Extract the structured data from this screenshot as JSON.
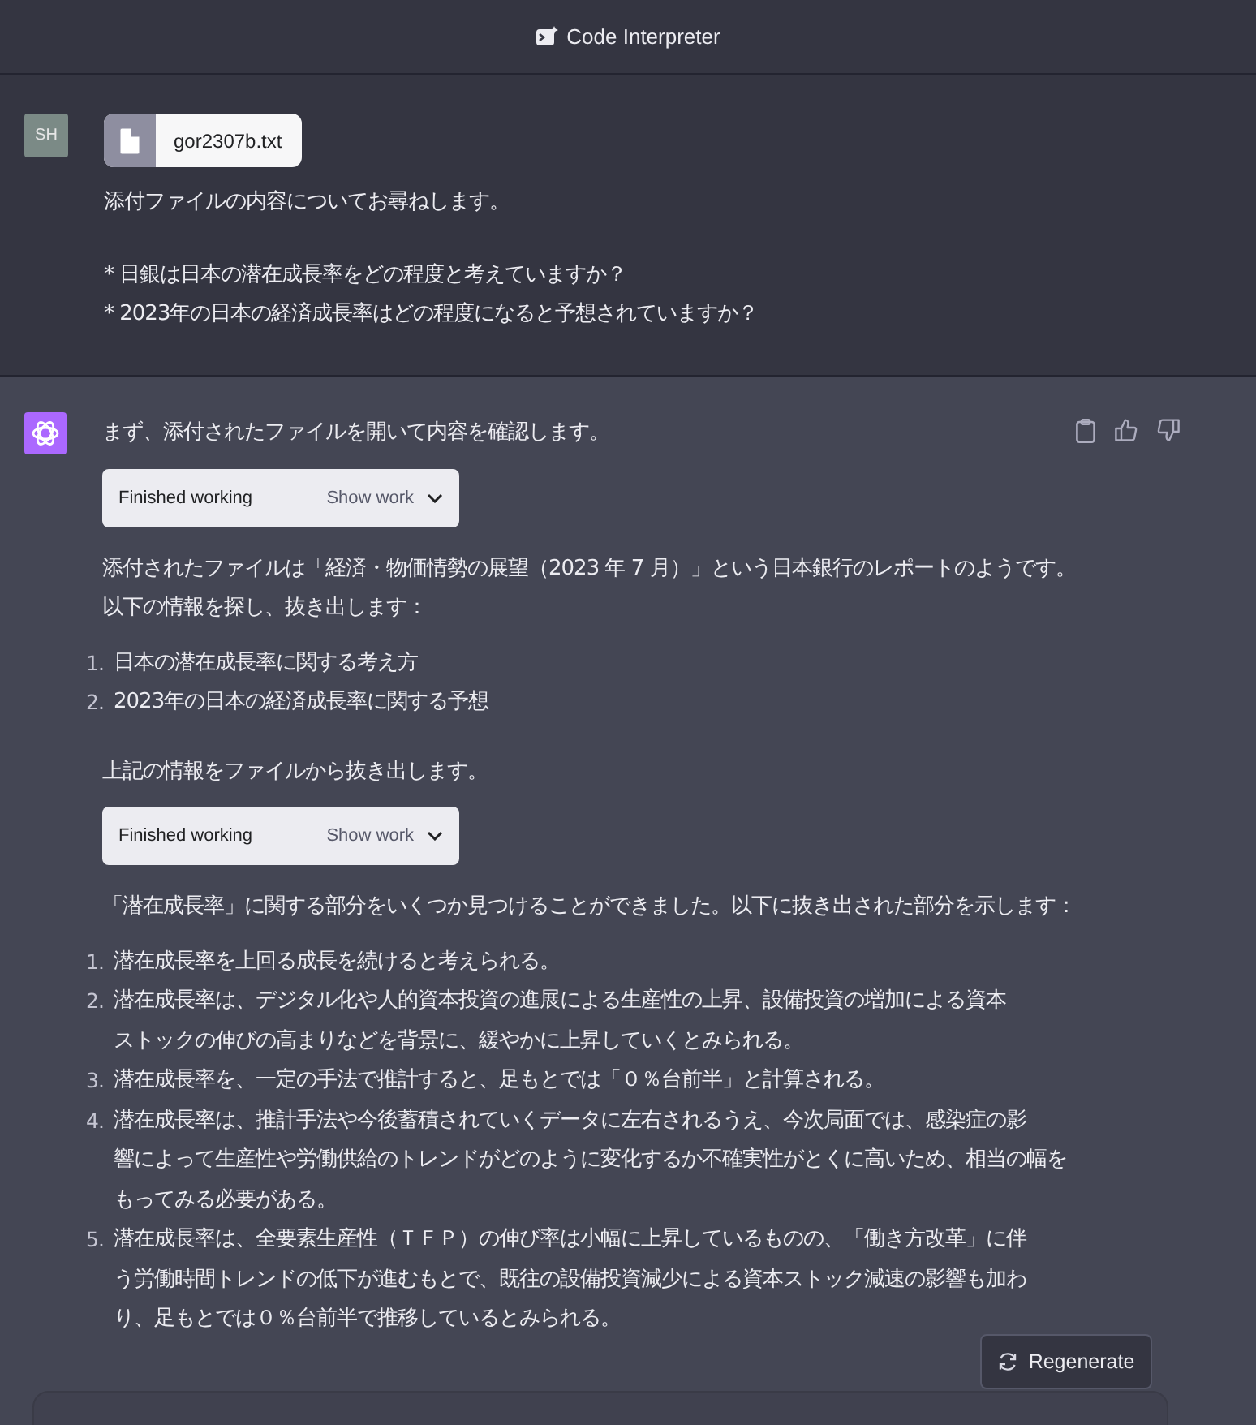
{
  "header": {
    "title": "Code Interpreter"
  },
  "user_message": {
    "avatar": "SH",
    "file": {
      "name": "gor2307b.txt"
    },
    "paragraphs": [
      [
        "添付ファイルの内容についてお尋ねします。"
      ],
      [
        "* 日銀は日本の潜在成長率をどの程度と考えていますか？",
        "* 2023年の日本の経済成長率はどの程度になると予想されていますか？"
      ]
    ]
  },
  "assistant_message": {
    "blocks": [
      {
        "kind": "paragraph",
        "lines": [
          "まず、添付されたファイルを開いて内容を確認します。"
        ]
      },
      {
        "kind": "tool",
        "status": "Finished working",
        "action": "Show work"
      },
      {
        "kind": "paragraph",
        "lines": [
          "添付されたファイルは「経済・物価情勢の展望（2023 年 7 月）」という日本銀行のレポートのようです。",
          "以下の情報を探し、抜き出します："
        ]
      },
      {
        "kind": "list",
        "items": [
          {
            "number": "1.",
            "lines": [
              "日本の潜在成長率に関する考え方"
            ]
          },
          {
            "number": "2.",
            "lines": [
              "2023年の日本の経済成長率に関する予想"
            ]
          }
        ]
      },
      {
        "kind": "paragraph",
        "lines": [
          "上記の情報をファイルから抜き出します。"
        ]
      },
      {
        "kind": "tool",
        "status": "Finished working",
        "action": "Show work"
      },
      {
        "kind": "paragraph",
        "lines": [
          "「潜在成長率」に関する部分をいくつか見つけることができました。以下に抜き出された部分を示します："
        ]
      },
      {
        "kind": "list",
        "items": [
          {
            "number": "1.",
            "lines": [
              "潜在成長率を上回る成長を続けると考えられる。"
            ]
          },
          {
            "number": "2.",
            "lines": [
              "潜在成長率は、デジタル化や人的資本投資の進展による生産性の上昇、設備投資の増加による資本",
              "ストックの伸びの高まりなどを背景に、緩やかに上昇していくとみられる。"
            ]
          },
          {
            "number": "3.",
            "lines": [
              "潜在成長率を、一定の手法で推計すると、足もとでは「０％台前半」と計算される。"
            ]
          },
          {
            "number": "4.",
            "lines": [
              "潜在成長率は、推計手法や今後蓄積されていくデータに左右されるうえ、今次局面では、感染症の影",
              "響によって生産性や労働供給のトレンドがどのように変化するか不確実性がとくに高いため、相当の幅を",
              "もってみる必要がある。"
            ]
          },
          {
            "number": "5.",
            "lines": [
              "潜在成長率は、全要素生産性（ＴＦＰ）の伸び率は小幅に上昇しているものの、「働き方改革」に伴",
              "う労働時間トレンドの低下が進むもとで、既往の設備投資減少による資本ストック減速の影響も加わ",
              "り、足もとでは０％台前半で推移しているとみられる。"
            ]
          }
        ]
      }
    ]
  },
  "regenerate_button": {
    "label": "Regenerate"
  }
}
